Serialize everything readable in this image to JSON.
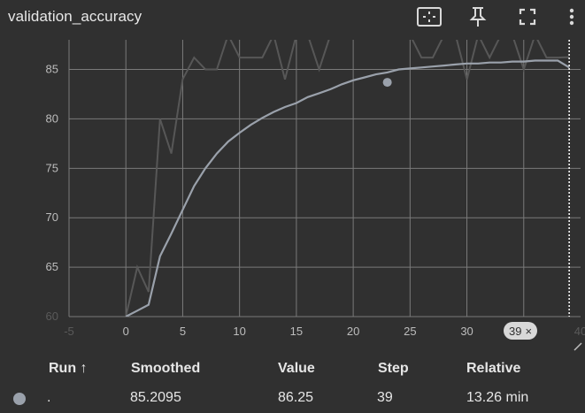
{
  "header": {
    "title": "validation_accuracy",
    "icons": [
      "fit-domain-icon",
      "pin-icon",
      "fullscreen-icon",
      "more-vert-icon"
    ]
  },
  "table": {
    "headers": [
      "Run ↑",
      "Smoothed",
      "Value",
      "Step",
      "Relative"
    ],
    "row": {
      "run": ".",
      "smoothed": "85.2095",
      "value": "86.25",
      "step": "39",
      "relative": "13.26 min",
      "color": "#9aa1ab"
    }
  },
  "step_badge": {
    "label": "39",
    "close": "×"
  },
  "chart_data": {
    "type": "line",
    "title": "validation_accuracy",
    "xlabel": "",
    "ylabel": "",
    "xlim": [
      -5,
      40
    ],
    "ylim": [
      60,
      88
    ],
    "x_ticks": [
      -5,
      0,
      5,
      10,
      15,
      20,
      25,
      30,
      35,
      40
    ],
    "x_tick_labels": [
      "-5",
      "0",
      "5",
      "10",
      "15",
      "20",
      "25",
      "30",
      "35",
      "40"
    ],
    "y_ticks": [
      60,
      65,
      70,
      75,
      80,
      85
    ],
    "y_tick_labels": [
      "60",
      "65",
      "70",
      "75",
      "80",
      "85"
    ],
    "grid": true,
    "cursor_step": 39,
    "highlight": {
      "x": 23,
      "y": 83.7
    },
    "colors": {
      "smoothed": "#9aa1ab",
      "raw": "#575757"
    },
    "series": [
      {
        "name": "Value",
        "role": "raw",
        "x": [
          0,
          1,
          2,
          3,
          4,
          5,
          6,
          7,
          8,
          9,
          10,
          11,
          12,
          13,
          14,
          15,
          16,
          17,
          18,
          19,
          20,
          21,
          22,
          23,
          24,
          25,
          26,
          27,
          28,
          29,
          30,
          31,
          32,
          33,
          34,
          35,
          36,
          37,
          38,
          39
        ],
        "y": [
          60,
          65,
          62.5,
          80,
          76.5,
          84,
          86.2,
          85,
          85,
          88.5,
          86.2,
          86.2,
          86.2,
          88.5,
          84,
          88.5,
          88.5,
          85,
          88.5,
          88.5,
          88.5,
          88.5,
          88.5,
          88.5,
          88.5,
          88.5,
          86.2,
          86.2,
          88.5,
          88.5,
          84,
          88.5,
          86.2,
          88.5,
          88.5,
          85,
          88.5,
          86.2,
          86.2,
          86.25
        ]
      },
      {
        "name": "Smoothed",
        "role": "smoothed",
        "x": [
          0,
          1,
          2,
          3,
          4,
          5,
          6,
          7,
          8,
          9,
          10,
          11,
          12,
          13,
          14,
          15,
          16,
          17,
          18,
          19,
          20,
          21,
          22,
          23,
          24,
          25,
          26,
          27,
          28,
          29,
          30,
          31,
          32,
          33,
          34,
          35,
          36,
          37,
          38,
          39
        ],
        "y": [
          60,
          60.6,
          61.2,
          66.1,
          68.4,
          70.8,
          73.2,
          75,
          76.5,
          77.7,
          78.6,
          79.4,
          80.1,
          80.7,
          81.2,
          81.6,
          82.2,
          82.6,
          83,
          83.5,
          83.9,
          84.2,
          84.5,
          84.7,
          85,
          85.1,
          85.2,
          85.3,
          85.4,
          85.5,
          85.6,
          85.6,
          85.7,
          85.7,
          85.8,
          85.8,
          85.9,
          85.9,
          85.9,
          85.2
        ]
      }
    ]
  }
}
